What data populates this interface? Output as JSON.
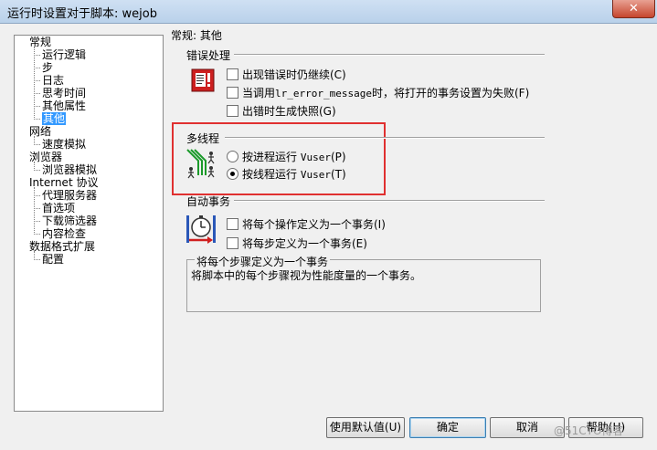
{
  "window": {
    "title": "运行时设置对于脚本: wejob",
    "close": "✕"
  },
  "tree": {
    "items": [
      {
        "label": "常规",
        "level": 0
      },
      {
        "label": "运行逻辑",
        "level": 1
      },
      {
        "label": "步",
        "level": 1
      },
      {
        "label": "日志",
        "level": 1
      },
      {
        "label": "思考时间",
        "level": 1
      },
      {
        "label": "其他属性",
        "level": 1
      },
      {
        "label": "其他",
        "level": 1,
        "selected": true
      },
      {
        "label": "网络",
        "level": 0
      },
      {
        "label": "速度模拟",
        "level": 1
      },
      {
        "label": "浏览器",
        "level": 0
      },
      {
        "label": "浏览器模拟",
        "level": 1
      },
      {
        "label": "Internet 协议",
        "level": 0
      },
      {
        "label": "代理服务器",
        "level": 1
      },
      {
        "label": "首选项",
        "level": 1
      },
      {
        "label": "下载筛选器",
        "level": 1
      },
      {
        "label": "内容检查",
        "level": 1
      },
      {
        "label": "数据格式扩展",
        "level": 0
      },
      {
        "label": "配置",
        "level": 1
      }
    ]
  },
  "panel": {
    "header": "常规: 其他",
    "error_handling": {
      "title": "错误处理",
      "opt1": "出现错误时仍继续(C)",
      "opt2_prefix": "当调用",
      "opt2_code": "lr_error_message",
      "opt2_suffix": "时，将打开的事务设置为失败(F)",
      "opt3": "出错时生成快照(G)"
    },
    "multithreading": {
      "title": "多线程",
      "opt1_prefix": "按进程运行 ",
      "opt1_code": "Vuser",
      "opt1_suffix": "(P)",
      "opt2_prefix": "按线程运行 ",
      "opt2_code": "Vuser",
      "opt2_suffix": "(T)",
      "selected": "thread"
    },
    "auto_transaction": {
      "title": "自动事务",
      "opt1": "将每个操作定义为一个事务(I)",
      "opt2": "将每步定义为一个事务(E)"
    },
    "description": {
      "title": "将每个步骤定义为一个事务",
      "text": "将脚本中的每个步骤视为性能度量的一个事务。"
    }
  },
  "buttons": {
    "defaults": "使用默认值(U)",
    "ok": "确定",
    "cancel": "取消",
    "help": "帮助(H)"
  },
  "watermark": "@51CTO博客",
  "colors": {
    "highlight": "#e03030",
    "selection": "#3399ff"
  }
}
